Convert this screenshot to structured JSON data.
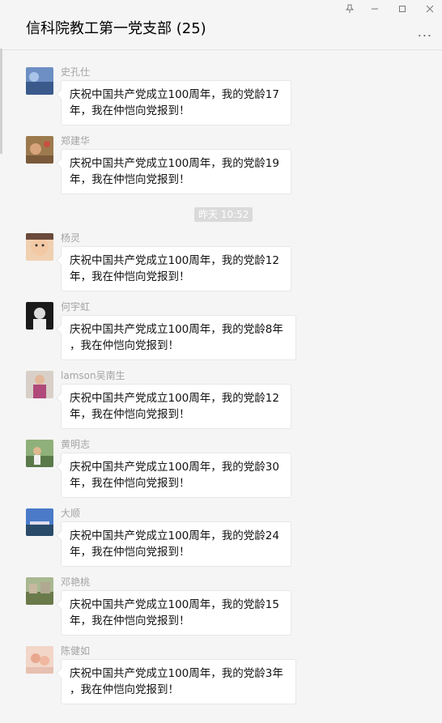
{
  "window": {
    "title": "信科院教工第一党支部 (25)",
    "pin_icon": "pin-icon",
    "minimize_icon": "minimize-icon",
    "maximize_icon": "maximize-icon",
    "close_icon": "close-icon",
    "more_icon": "more-options-icon",
    "more_text": "..."
  },
  "timestamp": "昨天 10:52",
  "messages": [
    {
      "sender": "史孔仕",
      "line1": "庆祝中国共产党成立100周年，我的党龄17",
      "line2": "年，我在仲恺向党报到！",
      "avatar_color": "#3a5a8c"
    },
    {
      "sender": "郑建华",
      "line1": "庆祝中国共产党成立100周年，我的党龄19",
      "line2": "年，我在仲恺向党报到！",
      "avatar_color": "#7a5a3a"
    },
    {
      "sender": "杨灵",
      "line1": "庆祝中国共产党成立100周年，我的党龄12",
      "line2": "年，我在仲恺向党报到！",
      "avatar_color": "#d9a37a"
    },
    {
      "sender": "何宇虹",
      "line1": "庆祝中国共产党成立100周年，我的党龄8年",
      "line2": "，我在仲恺向党报到！",
      "avatar_color": "#222222"
    },
    {
      "sender": "lamson吴南生",
      "line1": "庆祝中国共产党成立100周年，我的党龄12",
      "line2": "年，我在仲恺向党报到！",
      "avatar_color": "#b04a7a"
    },
    {
      "sender": "黄明志",
      "line1": "庆祝中国共产党成立100周年，我的党龄30",
      "line2": "年，我在仲恺向党报到！",
      "avatar_color": "#5a7a4a"
    },
    {
      "sender": "大顺",
      "line1": "庆祝中国共产党成立100周年，我的党龄24",
      "line2": "年，我在仲恺向党报到！",
      "avatar_color": "#4a6a9a"
    },
    {
      "sender": "邓艳桃",
      "line1": "庆祝中国共产党成立100周年，我的党龄15",
      "line2": "年，我在仲恺向党报到！",
      "avatar_color": "#7a8a5a"
    },
    {
      "sender": "陈健如",
      "line1": "庆祝中国共产党成立100周年，我的党龄3年",
      "line2": "，我在仲恺向党报到！",
      "avatar_color": "#e6b8a2"
    }
  ]
}
